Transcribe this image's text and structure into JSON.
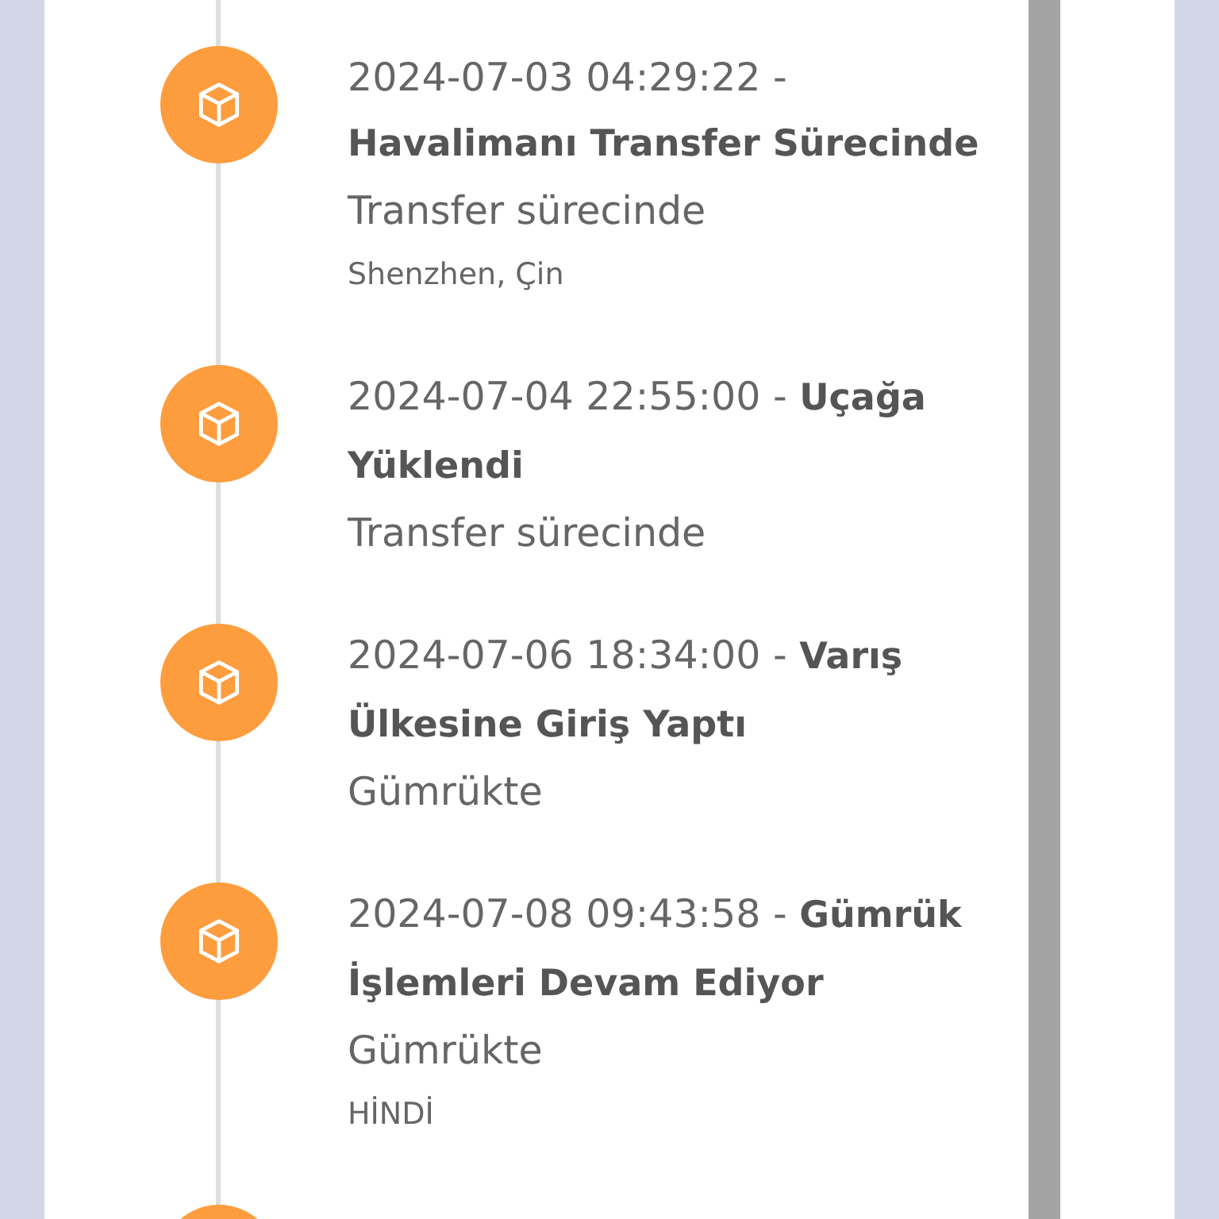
{
  "events": [
    {
      "title": "2024-07-03 04:29:22 - **Havalimanı Transfer Sürecinde**",
      "status": "Transfer sürecinde",
      "location": "Shenzhen, Çin"
    },
    {
      "title": "2024-07-04 22:55:00 - **Uçağa Yüklendi**",
      "status": "Transfer sürecinde"
    },
    {
      "title": "2024-07-06 18:34:00 - **Varış Ülkesine Giriş Yaptı**",
      "status": "Gümrükte"
    },
    {
      "title": "2024-07-08 09:43:58 - **Gümrük İşlemleri Devam Ediyor**",
      "status": "Gümrükte",
      "location": "HİNDİ"
    }
  ]
}
